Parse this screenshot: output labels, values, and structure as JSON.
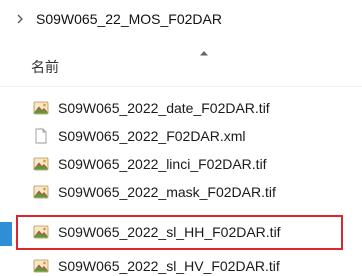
{
  "breadcrumb": {
    "separator_icon": "chevron-right-icon",
    "folder": "S09W065_22_MOS_F02DAR"
  },
  "header": {
    "column_name": "名前",
    "sort_icon": "sort-ascending-icon"
  },
  "files": [
    {
      "name": "S09W065_2022_date_F02DAR.tif",
      "icon": "tif-image-icon"
    },
    {
      "name": "S09W065_2022_F02DAR.xml",
      "icon": "xml-file-icon"
    },
    {
      "name": "S09W065_2022_linci_F02DAR.tif",
      "icon": "tif-image-icon"
    },
    {
      "name": "S09W065_2022_mask_F02DAR.tif",
      "icon": "tif-image-icon"
    },
    {
      "name": "S09W065_2022_sl_HH_F02DAR.tif",
      "icon": "tif-image-icon",
      "highlighted": true
    },
    {
      "name": "S09W065_2022_sl_HV_F02DAR.tif",
      "icon": "tif-image-icon"
    }
  ],
  "colors": {
    "highlight_border": "#d9262f",
    "selection_accent": "#2e8fd8"
  }
}
